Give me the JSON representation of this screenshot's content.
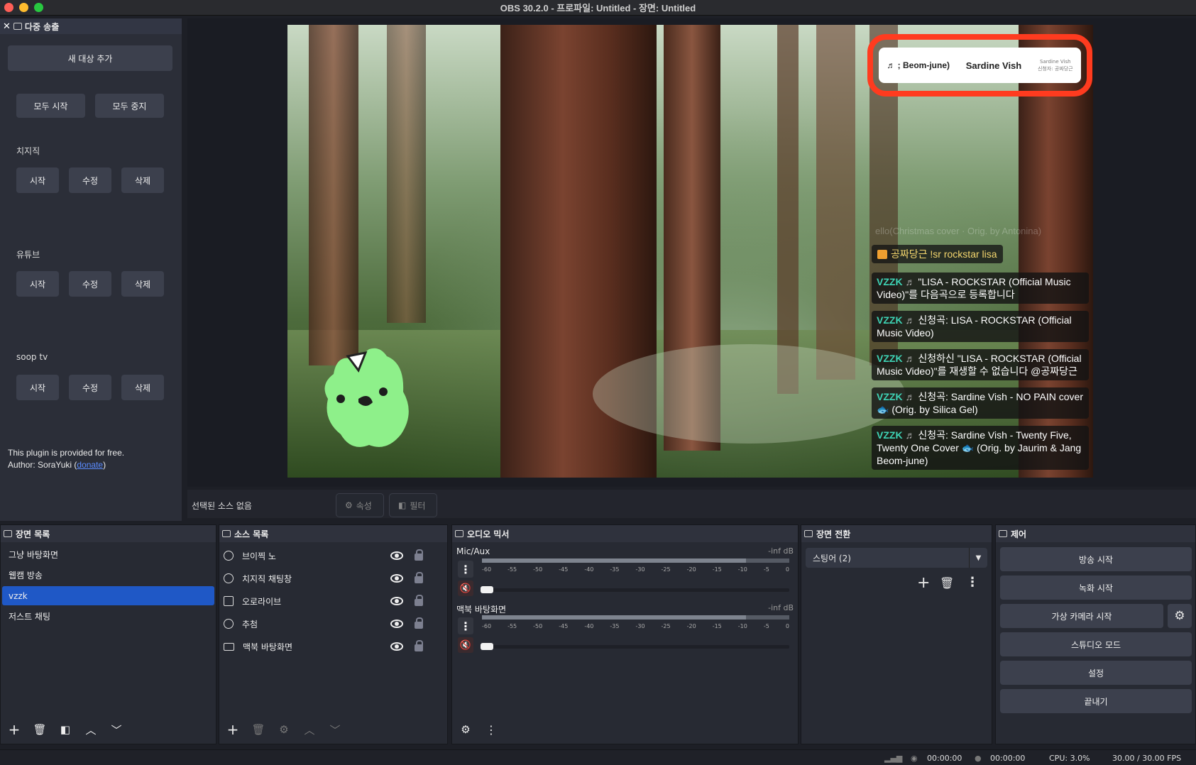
{
  "window": {
    "title": "OBS 30.2.0 - 프로파일: Untitled - 장면: Untitled"
  },
  "multistream": {
    "title": "다중 송출",
    "add_target": "새 대상 추가",
    "start_all": "모두 시작",
    "stop_all": "모두 중지",
    "targets": [
      {
        "name": "치지직",
        "start": "시작",
        "edit": "수정",
        "delete": "삭제"
      },
      {
        "name": "유튜브",
        "start": "시작",
        "edit": "수정",
        "delete": "삭제"
      },
      {
        "name": "soop tv",
        "start": "시작",
        "edit": "수정",
        "delete": "삭제"
      }
    ],
    "note_line1": "This plugin is provided for free.",
    "note_author": "Author: SoraYuki (",
    "note_link": "donate",
    "note_close": ")"
  },
  "preview": {
    "now_playing": {
      "left": "♬ ; Beom-june)",
      "center": "Sardine Vish",
      "right_line1": "Sardine Vish",
      "right_line2": "신청자: 공짜당근"
    },
    "chat_faded": "ello(Christmas cover · Orig. by Antonina)",
    "chat_top": "공짜당근 !sr rockstar lisa",
    "chat_messages": [
      {
        "src": "VZZK",
        "note": "♬",
        "text": "\"LISA - ROCKSTAR (Official Music Video)\"를 다음곡으로 등록합니다"
      },
      {
        "src": "VZZK",
        "note": "♬",
        "text": "신청곡: LISA - ROCKSTAR (Official Music Video)"
      },
      {
        "src": "VZZK",
        "note": "♬",
        "text": "신청하신 \"LISA - ROCKSTAR (Official Music Video)\"를 재생할 수 없습니다 @공짜당근"
      },
      {
        "src": "VZZK",
        "note": "♬",
        "text": "신청곡: Sardine Vish - NO PAIN cover 🐟 (Orig. by Silica Gel)"
      },
      {
        "src": "VZZK",
        "note": "♬",
        "text": "신청곡: Sardine Vish - Twenty Five, Twenty One Cover 🐟 (Orig. by Jaurim & Jang Beom-june)"
      }
    ]
  },
  "props_bar": {
    "no_source": "선택된 소스 없음",
    "properties": "속성",
    "filters": "필터"
  },
  "scenes": {
    "title": "장면 목록",
    "items": [
      "그냥 바탕화면",
      "웹캠 방송",
      "vzzk",
      "저스트 채팅"
    ],
    "selected_index": 2
  },
  "sources": {
    "title": "소스 목록",
    "items": [
      {
        "name": "브이찍 노",
        "icon": "globe-icon"
      },
      {
        "name": "치지직 채팅창",
        "icon": "globe-icon"
      },
      {
        "name": "오로라이브",
        "icon": "image-icon"
      },
      {
        "name": "추첨",
        "icon": "globe-icon"
      },
      {
        "name": "맥북 바탕화면",
        "icon": "monitor-icon"
      }
    ]
  },
  "mixer": {
    "title": "오디오 믹서",
    "channels": [
      {
        "name": "Mic/Aux",
        "db": "-inf dB"
      },
      {
        "name": "맥북 바탕화면",
        "db": "-inf dB"
      }
    ],
    "scale": [
      "-60",
      "-55",
      "-50",
      "-45",
      "-40",
      "-35",
      "-30",
      "-25",
      "-20",
      "-15",
      "-10",
      "-5",
      "0"
    ]
  },
  "transitions": {
    "title": "장면 전환",
    "selected": "스팅어 (2)"
  },
  "controls": {
    "title": "제어",
    "start_streaming": "방송 시작",
    "start_recording": "녹화 시작",
    "start_virtual_cam": "가상 카메라 시작",
    "studio_mode": "스튜디오 모드",
    "settings": "설정",
    "exit": "끝내기"
  },
  "status": {
    "stream_time": "00:00:00",
    "rec_time": "00:00:00",
    "cpu": "CPU: 3.0%",
    "fps": "30.00 / 30.00 FPS"
  }
}
